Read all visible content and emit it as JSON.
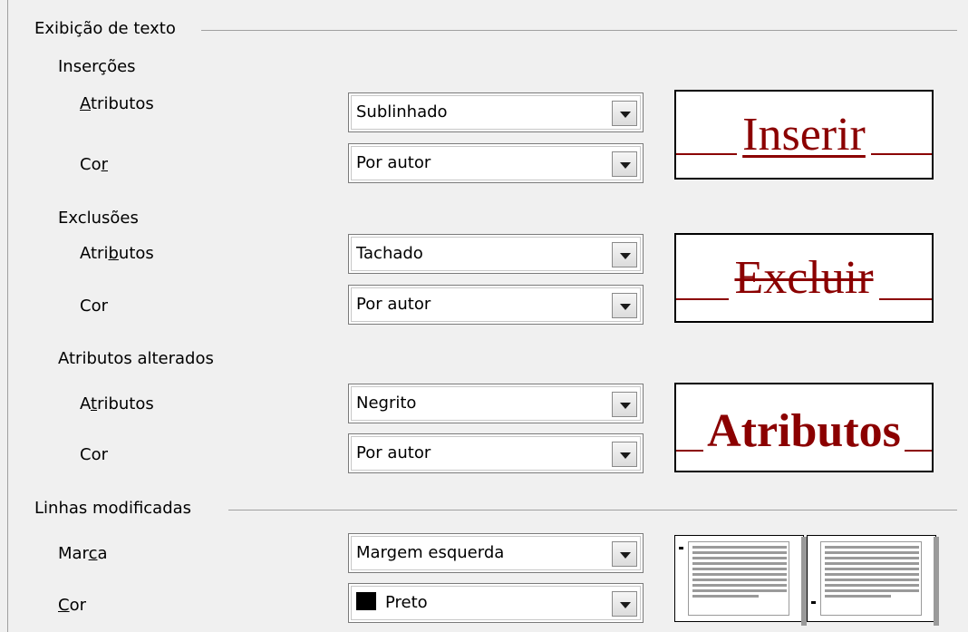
{
  "text_display": {
    "title": "Exibição de texto",
    "insertions": {
      "title": "Inserções",
      "attributes_label": "Atributos",
      "attributes_value": "Sublinhado",
      "color_label": "Cor",
      "color_value": "Por autor",
      "preview_text": "Inserir"
    },
    "deletions": {
      "title": "Exclusões",
      "attributes_label": "Atributos",
      "attributes_value": "Tachado",
      "color_label": "Cor",
      "color_value": "Por autor",
      "preview_text": "Excluir"
    },
    "changed_attributes": {
      "title": "Atributos alterados",
      "attributes_label": "Atributos",
      "attributes_value": "Negrito",
      "color_label": "Cor",
      "color_value": "Por autor",
      "preview_text": "Atributos"
    }
  },
  "changed_lines": {
    "title": "Linhas modificadas",
    "mark_label": "Marca",
    "mark_value": "Margem esquerda",
    "color_label": "Cor",
    "color_value": "Preto",
    "color_swatch": "#000000"
  },
  "colors": {
    "preview_text": "#8b0000",
    "background": "#f0f0f0"
  }
}
